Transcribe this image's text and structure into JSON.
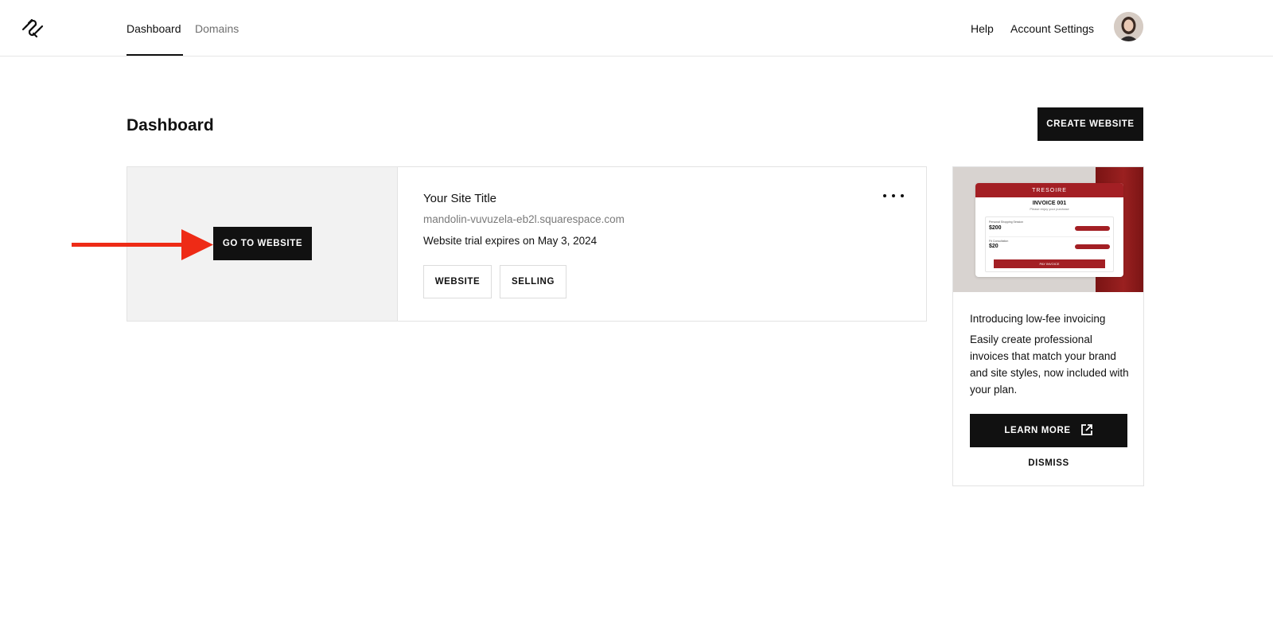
{
  "header": {
    "logo_icon": "squarespace-logo-icon",
    "tabs": [
      {
        "label": "Dashboard",
        "active": true
      },
      {
        "label": "Domains",
        "active": false
      }
    ],
    "help_label": "Help",
    "account_label": "Account Settings",
    "avatar_icon": "user-avatar"
  },
  "page": {
    "title": "Dashboard",
    "create_label": "CREATE WEBSITE"
  },
  "site": {
    "go_label": "GO TO WEBSITE",
    "title": "Your Site Title",
    "url": "mandolin-vuvuzela-eb2l.squarespace.com",
    "trial": "Website trial expires on May 3, 2024",
    "buttons": [
      "WEBSITE",
      "SELLING"
    ],
    "more_icon": "more-horizontal-icon"
  },
  "annotation": {
    "arrow_color": "#ee2b16"
  },
  "promo": {
    "image": {
      "brand": "TRESOIRE",
      "invoice_title": "INVOICE 001",
      "invoice_sub": "Please enjoy your purchase",
      "line1": "Personal Shopping Session",
      "amount1": "$200",
      "line2": "Fit Consultation",
      "amount2": "$20",
      "pay_label": "PAY INVOICE",
      "accent": "#a31f24"
    },
    "heading": "Introducing low-fee invoicing",
    "body": "Easily create professional invoices that match your brand and site styles, now included with your plan.",
    "learn_label": "LEARN MORE",
    "learn_icon": "external-link-icon",
    "dismiss_label": "DISMISS"
  }
}
